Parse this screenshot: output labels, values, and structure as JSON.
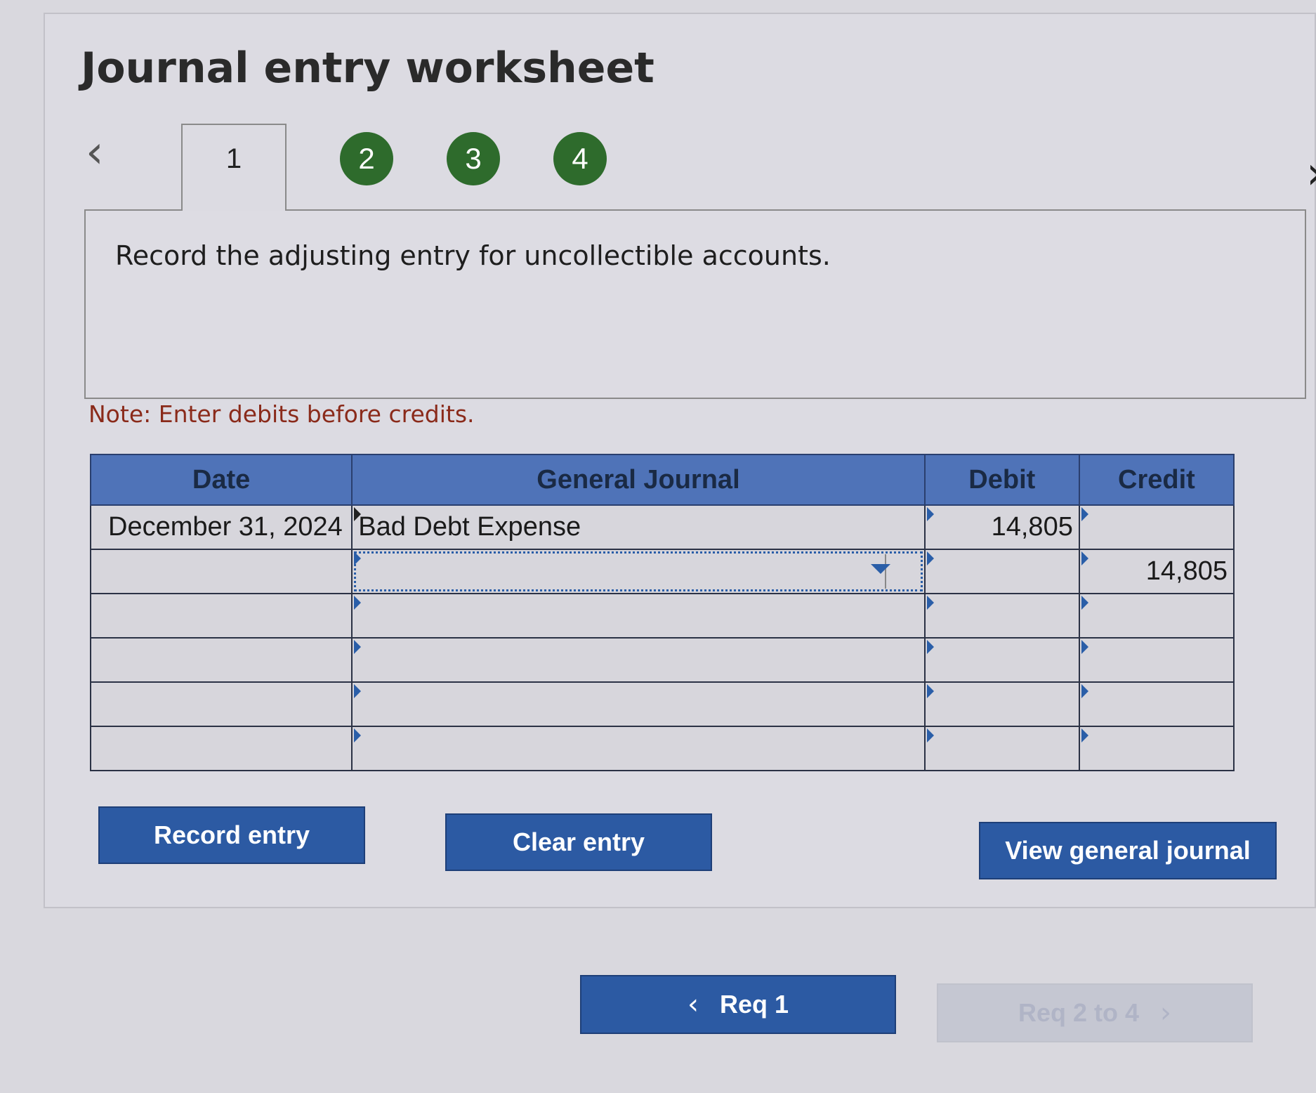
{
  "title": "Journal entry worksheet",
  "nav": {
    "prev_icon": "chevron-left-icon",
    "next_icon": "chevron-right-icon"
  },
  "steps": [
    {
      "label": "1",
      "active": true
    },
    {
      "label": "2",
      "active": false
    },
    {
      "label": "3",
      "active": false
    },
    {
      "label": "4",
      "active": false
    }
  ],
  "instruction": "Record the adjusting entry for uncollectible accounts.",
  "note": "Note: Enter debits before credits.",
  "table": {
    "headers": {
      "date": "Date",
      "journal": "General Journal",
      "debit": "Debit",
      "credit": "Credit"
    },
    "rows": [
      {
        "date": "December 31, 2024",
        "account": "Bad Debt Expense",
        "debit": "14,805",
        "credit": ""
      },
      {
        "date": "",
        "account": "",
        "debit": "",
        "credit": "14,805"
      },
      {
        "date": "",
        "account": "",
        "debit": "",
        "credit": ""
      },
      {
        "date": "",
        "account": "",
        "debit": "",
        "credit": ""
      },
      {
        "date": "",
        "account": "",
        "debit": "",
        "credit": ""
      },
      {
        "date": "",
        "account": "",
        "debit": "",
        "credit": ""
      }
    ]
  },
  "buttons": {
    "record": "Record entry",
    "clear": "Clear entry",
    "view": "View general journal"
  },
  "footer": {
    "prev": "Req 1",
    "next": "Req 2 to 4"
  },
  "colors": {
    "header_blue": "#4f73b8",
    "button_blue": "#2c5aa3",
    "step_green": "#2e6b2c",
    "note_red": "#8a2a1a"
  }
}
